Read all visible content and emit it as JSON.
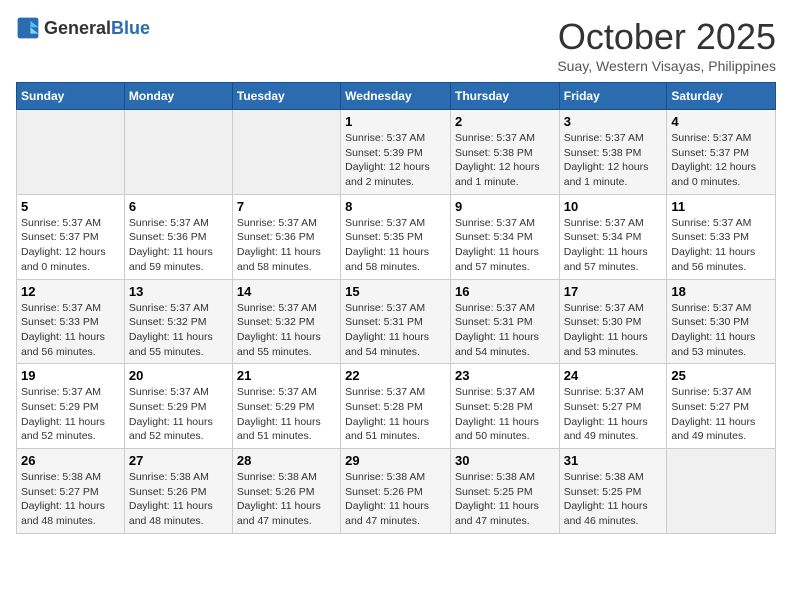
{
  "header": {
    "logo_general": "General",
    "logo_blue": "Blue",
    "month": "October 2025",
    "location": "Suay, Western Visayas, Philippines"
  },
  "weekdays": [
    "Sunday",
    "Monday",
    "Tuesday",
    "Wednesday",
    "Thursday",
    "Friday",
    "Saturday"
  ],
  "weeks": [
    [
      {
        "day": "",
        "info": ""
      },
      {
        "day": "",
        "info": ""
      },
      {
        "day": "",
        "info": ""
      },
      {
        "day": "1",
        "info": "Sunrise: 5:37 AM\nSunset: 5:39 PM\nDaylight: 12 hours and 2 minutes."
      },
      {
        "day": "2",
        "info": "Sunrise: 5:37 AM\nSunset: 5:38 PM\nDaylight: 12 hours and 1 minute."
      },
      {
        "day": "3",
        "info": "Sunrise: 5:37 AM\nSunset: 5:38 PM\nDaylight: 12 hours and 1 minute."
      },
      {
        "day": "4",
        "info": "Sunrise: 5:37 AM\nSunset: 5:37 PM\nDaylight: 12 hours and 0 minutes."
      }
    ],
    [
      {
        "day": "5",
        "info": "Sunrise: 5:37 AM\nSunset: 5:37 PM\nDaylight: 12 hours and 0 minutes."
      },
      {
        "day": "6",
        "info": "Sunrise: 5:37 AM\nSunset: 5:36 PM\nDaylight: 11 hours and 59 minutes."
      },
      {
        "day": "7",
        "info": "Sunrise: 5:37 AM\nSunset: 5:36 PM\nDaylight: 11 hours and 58 minutes."
      },
      {
        "day": "8",
        "info": "Sunrise: 5:37 AM\nSunset: 5:35 PM\nDaylight: 11 hours and 58 minutes."
      },
      {
        "day": "9",
        "info": "Sunrise: 5:37 AM\nSunset: 5:34 PM\nDaylight: 11 hours and 57 minutes."
      },
      {
        "day": "10",
        "info": "Sunrise: 5:37 AM\nSunset: 5:34 PM\nDaylight: 11 hours and 57 minutes."
      },
      {
        "day": "11",
        "info": "Sunrise: 5:37 AM\nSunset: 5:33 PM\nDaylight: 11 hours and 56 minutes."
      }
    ],
    [
      {
        "day": "12",
        "info": "Sunrise: 5:37 AM\nSunset: 5:33 PM\nDaylight: 11 hours and 56 minutes."
      },
      {
        "day": "13",
        "info": "Sunrise: 5:37 AM\nSunset: 5:32 PM\nDaylight: 11 hours and 55 minutes."
      },
      {
        "day": "14",
        "info": "Sunrise: 5:37 AM\nSunset: 5:32 PM\nDaylight: 11 hours and 55 minutes."
      },
      {
        "day": "15",
        "info": "Sunrise: 5:37 AM\nSunset: 5:31 PM\nDaylight: 11 hours and 54 minutes."
      },
      {
        "day": "16",
        "info": "Sunrise: 5:37 AM\nSunset: 5:31 PM\nDaylight: 11 hours and 54 minutes."
      },
      {
        "day": "17",
        "info": "Sunrise: 5:37 AM\nSunset: 5:30 PM\nDaylight: 11 hours and 53 minutes."
      },
      {
        "day": "18",
        "info": "Sunrise: 5:37 AM\nSunset: 5:30 PM\nDaylight: 11 hours and 53 minutes."
      }
    ],
    [
      {
        "day": "19",
        "info": "Sunrise: 5:37 AM\nSunset: 5:29 PM\nDaylight: 11 hours and 52 minutes."
      },
      {
        "day": "20",
        "info": "Sunrise: 5:37 AM\nSunset: 5:29 PM\nDaylight: 11 hours and 52 minutes."
      },
      {
        "day": "21",
        "info": "Sunrise: 5:37 AM\nSunset: 5:29 PM\nDaylight: 11 hours and 51 minutes."
      },
      {
        "day": "22",
        "info": "Sunrise: 5:37 AM\nSunset: 5:28 PM\nDaylight: 11 hours and 51 minutes."
      },
      {
        "day": "23",
        "info": "Sunrise: 5:37 AM\nSunset: 5:28 PM\nDaylight: 11 hours and 50 minutes."
      },
      {
        "day": "24",
        "info": "Sunrise: 5:37 AM\nSunset: 5:27 PM\nDaylight: 11 hours and 49 minutes."
      },
      {
        "day": "25",
        "info": "Sunrise: 5:37 AM\nSunset: 5:27 PM\nDaylight: 11 hours and 49 minutes."
      }
    ],
    [
      {
        "day": "26",
        "info": "Sunrise: 5:38 AM\nSunset: 5:27 PM\nDaylight: 11 hours and 48 minutes."
      },
      {
        "day": "27",
        "info": "Sunrise: 5:38 AM\nSunset: 5:26 PM\nDaylight: 11 hours and 48 minutes."
      },
      {
        "day": "28",
        "info": "Sunrise: 5:38 AM\nSunset: 5:26 PM\nDaylight: 11 hours and 47 minutes."
      },
      {
        "day": "29",
        "info": "Sunrise: 5:38 AM\nSunset: 5:26 PM\nDaylight: 11 hours and 47 minutes."
      },
      {
        "day": "30",
        "info": "Sunrise: 5:38 AM\nSunset: 5:25 PM\nDaylight: 11 hours and 47 minutes."
      },
      {
        "day": "31",
        "info": "Sunrise: 5:38 AM\nSunset: 5:25 PM\nDaylight: 11 hours and 46 minutes."
      },
      {
        "day": "",
        "info": ""
      }
    ]
  ]
}
